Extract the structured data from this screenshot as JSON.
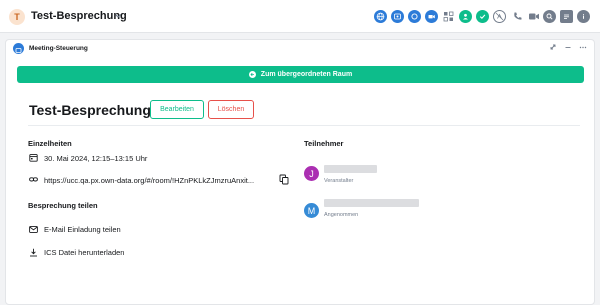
{
  "topbar": {
    "room_initial": "T",
    "room_title": "Test-Besprechung",
    "colors": {
      "accent": "#0dbd8b",
      "avatar_bg": "#fbe3cf",
      "avatar_fg": "#c9651f"
    },
    "icons": [
      "globe-icon",
      "team-icon",
      "meeting-icon",
      "video-icon",
      "grid-icon",
      "group-icon",
      "check-circle-icon",
      "no-network-icon",
      "phone-icon",
      "camera-icon",
      "search-icon",
      "threads-icon",
      "info-icon"
    ]
  },
  "panel": {
    "title": "Meeting-Steuerung",
    "parent_button_label": "Zum übergeordneten Raum",
    "meeting_title": "Test-Besprechung",
    "edit_label": "Bearbeiten",
    "delete_label": "Löschen",
    "details": {
      "heading": "Einzelheiten",
      "date_time": "30. Mai 2024, 12:15–13:15 Uhr",
      "link": "https://ucc.qa.px.own-data.org/#/room/!HZnPKLkZJmzruAnxit..."
    },
    "share": {
      "heading": "Besprechung teilen",
      "email_label": "E-Mail Einladung teilen",
      "ics_label": "ICS Datei herunterladen"
    },
    "participants": {
      "heading": "Teilnehmer",
      "items": [
        {
          "initial": "J",
          "role": "Veranstalter",
          "color": "#ab2fb2"
        },
        {
          "initial": "M",
          "role": "Angenommen",
          "color": "#368bd6"
        }
      ]
    }
  }
}
